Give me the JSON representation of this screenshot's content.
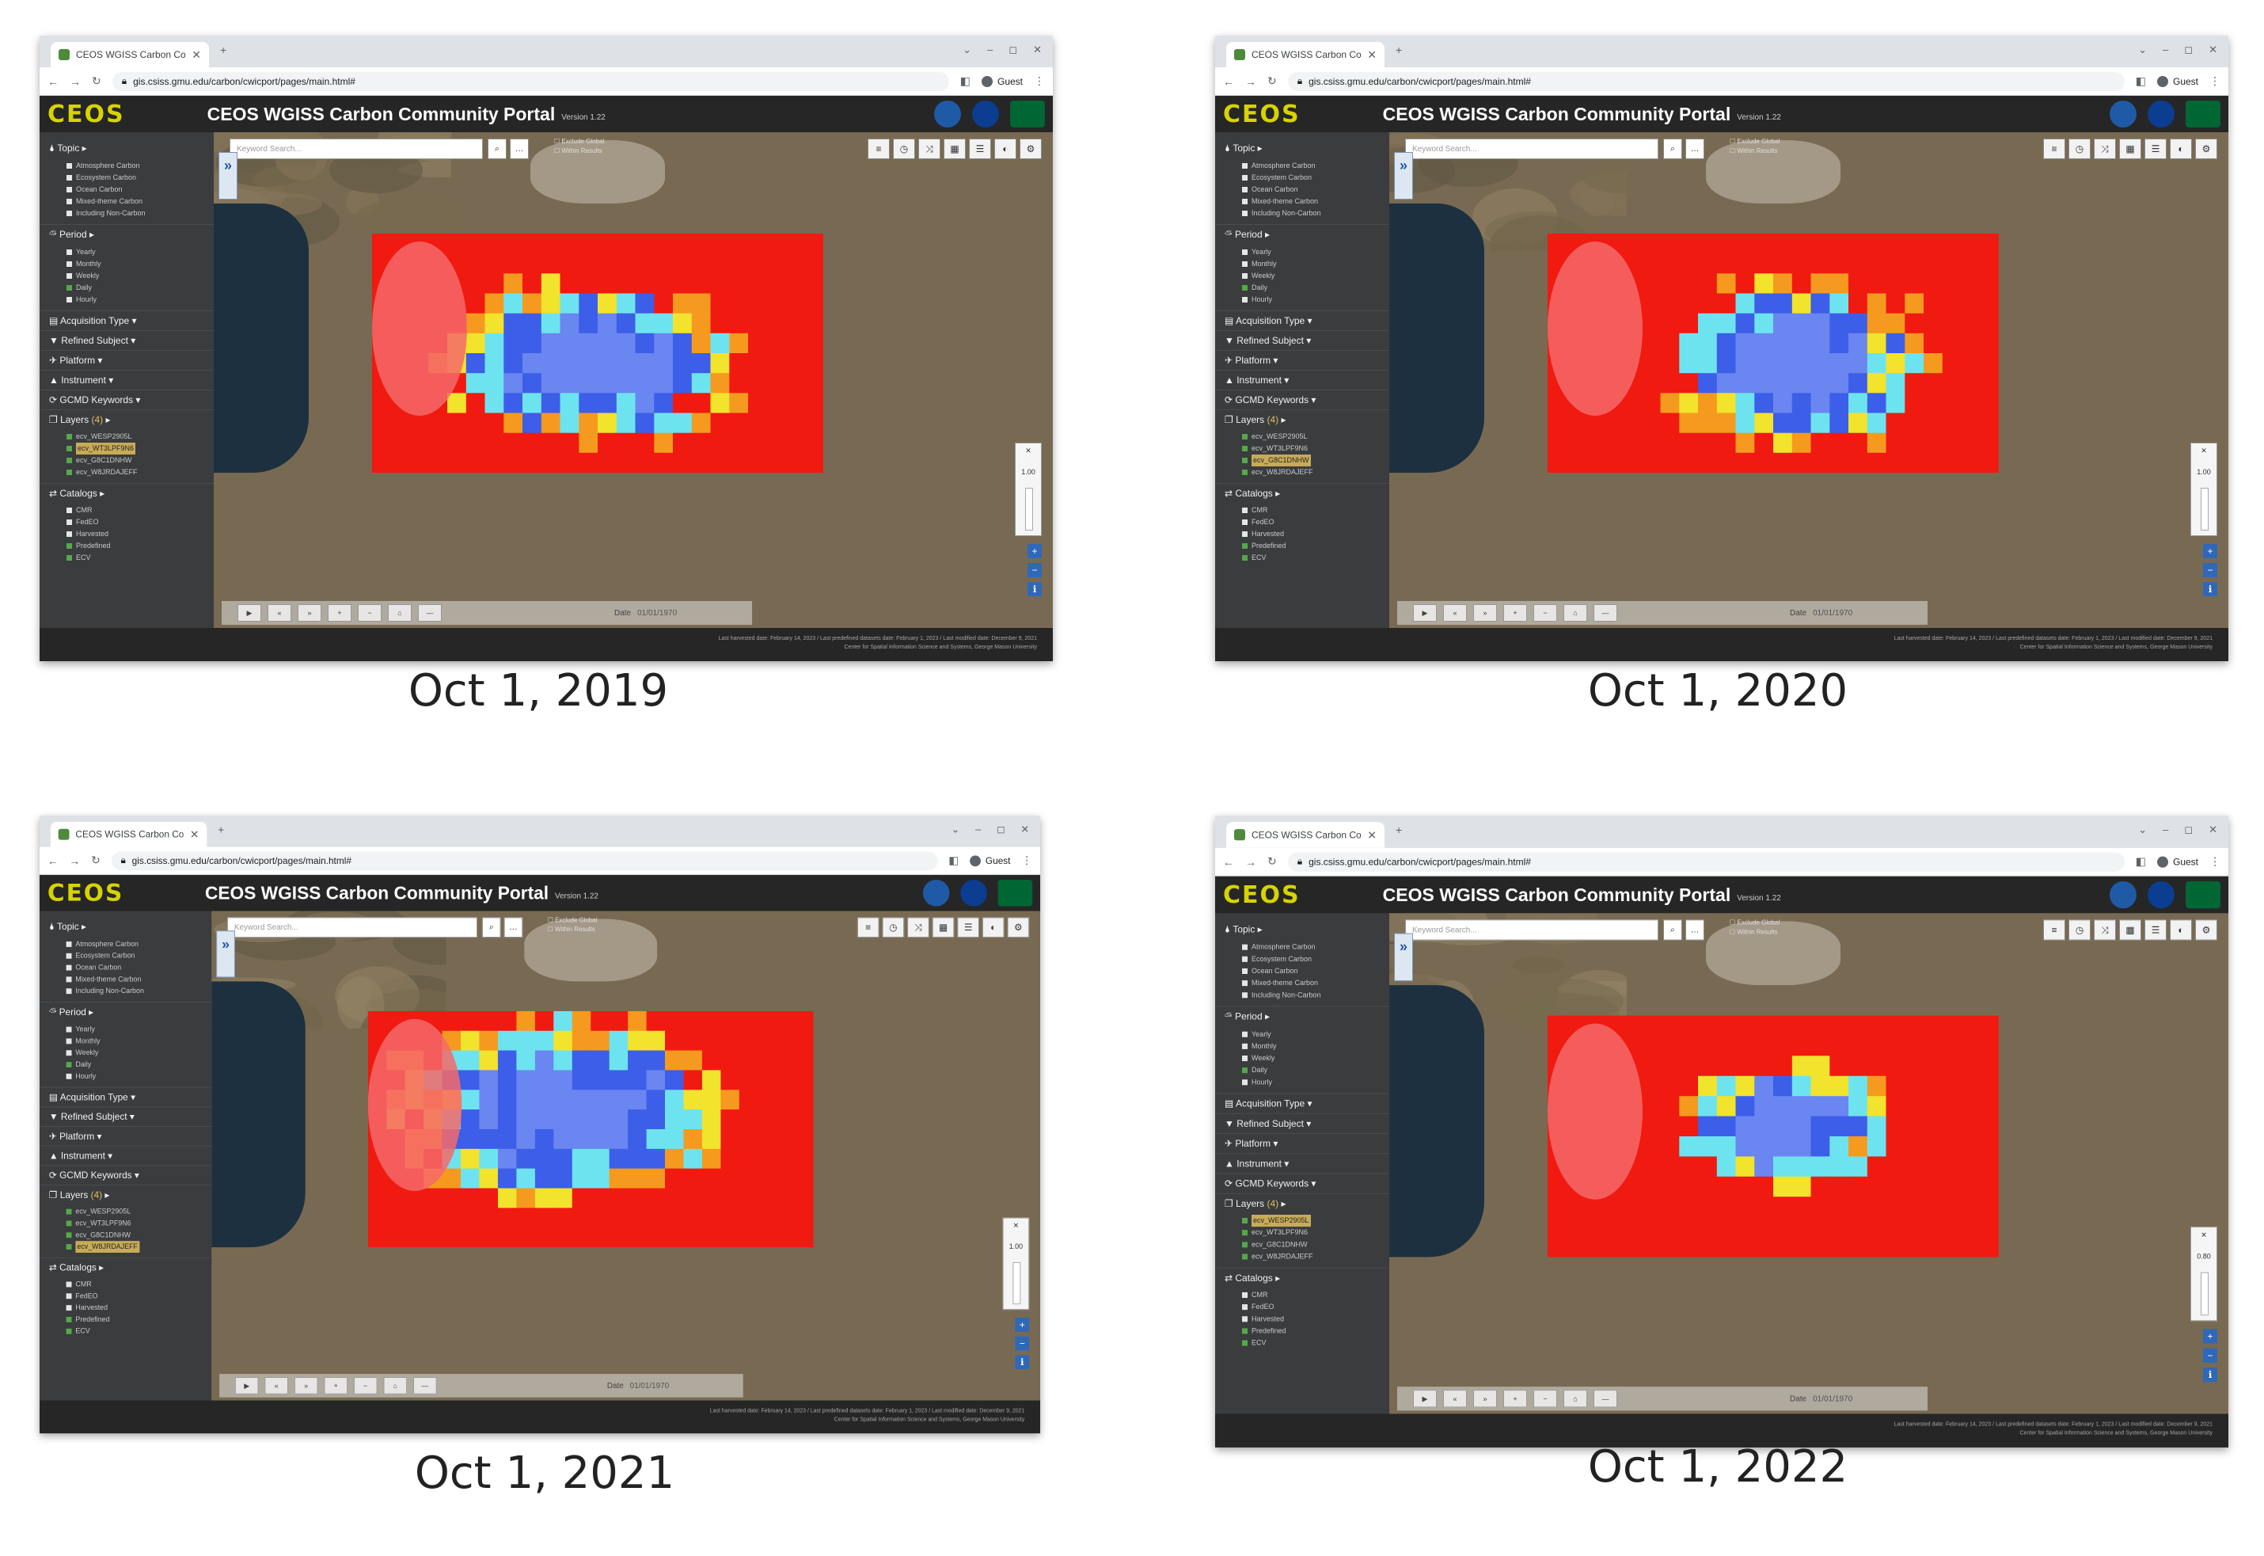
{
  "browser": {
    "tab_title": "CEOS WGISS Carbon Com",
    "url": "gis.csiss.gmu.edu/carbon/cwicport/pages/main.html#",
    "guest_label": "Guest"
  },
  "portal": {
    "logo": "CEOS",
    "title": "CEOS WGISS Carbon Community Portal",
    "version": "Version 1.22",
    "agency_logos": [
      "noaa-logo",
      "nasa-logo",
      "mason-logo"
    ]
  },
  "sidebar": {
    "topic": "Topic",
    "topic_items": [
      "Atmosphere Carbon",
      "Ecosystem Carbon",
      "Ocean Carbon",
      "Mixed-theme Carbon",
      "Including Non-Carbon"
    ],
    "period": "Period",
    "period_items": [
      "Yearly",
      "Monthly",
      "Weekly",
      "Daily",
      "Hourly"
    ],
    "acquisition": "Acquisition Type",
    "refined": "Refined Subject",
    "platform": "Platform",
    "instrument": "Instrument",
    "gcmd": "GCMD Keywords",
    "layers": "Layers",
    "layers_count": "(4)",
    "layer_items": [
      "ecv_WESP2905L",
      "ecv_WT3LPF9N6",
      "ecv_G8C1DNHW",
      "ecv_W8JRDAJEFF"
    ],
    "catalogs": "Catalogs",
    "catalog_items": [
      "CMR",
      "FedEO",
      "Harvested",
      "Predefined",
      "ECV"
    ]
  },
  "map": {
    "search_placeholder": "Keyword Search...",
    "exclude_global": "Exclude Global",
    "within_results": "Within Results",
    "opacity_values": [
      "1.00",
      "1.00",
      "1.00",
      "0.80"
    ],
    "time_label": "Date",
    "time_value": "01/01/1970"
  },
  "footer": {
    "line1": "Last harvested date: February 14, 2023 / Last predefined datasets date: February 1, 2023 / Last modified date: December 9, 2021",
    "line2": "Center for Spatial Information Science and Systems, George Mason University"
  },
  "captions": [
    "Oct 1, 2019",
    "Oct 1, 2020",
    "Oct 1, 2021",
    "Oct 1, 2022"
  ],
  "colors": {
    "heat_low": "#3d5ee8",
    "heat_mid": "#6ee3f0",
    "heat_high": "#f2e32c",
    "heat_max": "#f01a10",
    "header_bg": "#262626",
    "sidebar_bg": "#3a3c3e"
  }
}
